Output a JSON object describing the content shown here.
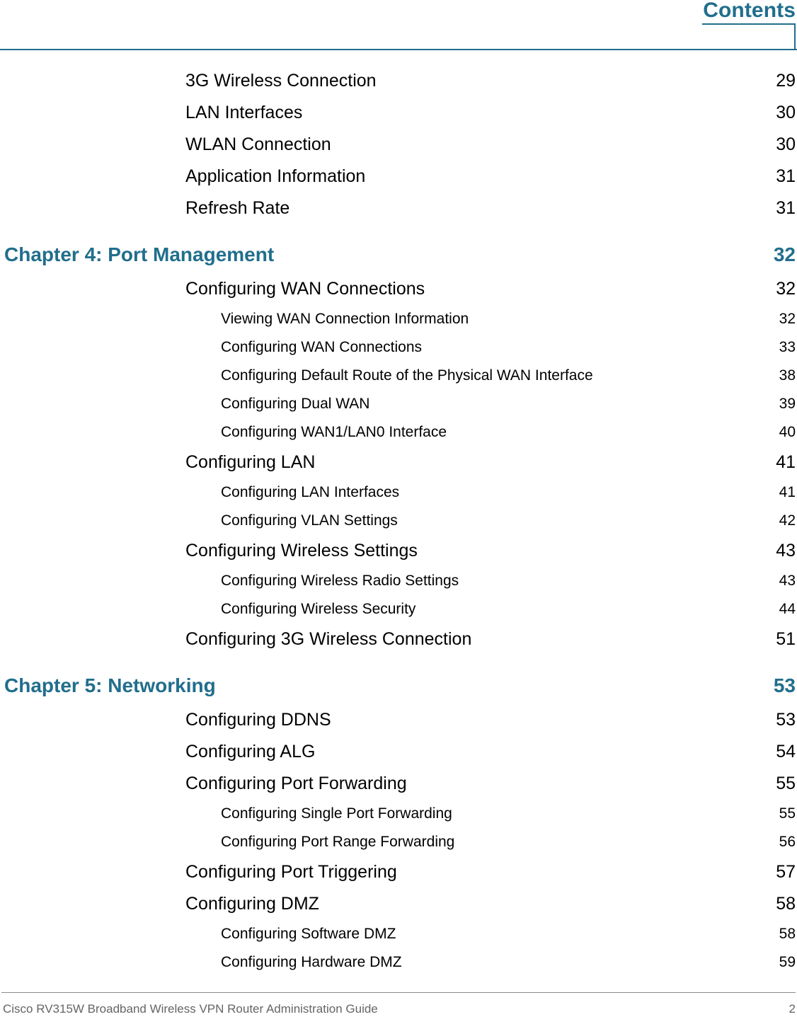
{
  "header": {
    "title": "Contents",
    "accent_color": "#216e8c"
  },
  "toc": {
    "entries": [
      {
        "level": 1,
        "label": "3G Wireless Connection",
        "page": "29"
      },
      {
        "level": 1,
        "label": "LAN Interfaces",
        "page": "30"
      },
      {
        "level": 1,
        "label": "WLAN Connection",
        "page": "30"
      },
      {
        "level": 1,
        "label": "Application Information",
        "page": "31"
      },
      {
        "level": 1,
        "label": "Refresh Rate",
        "page": "31"
      },
      {
        "level": 0,
        "label": "Chapter 4: Port Management",
        "page": "32"
      },
      {
        "level": 1,
        "label": "Configuring WAN Connections",
        "page": "32"
      },
      {
        "level": 2,
        "label": "Viewing WAN Connection Information",
        "page": "32"
      },
      {
        "level": 2,
        "label": "Configuring WAN Connections",
        "page": "33"
      },
      {
        "level": 2,
        "label": "Configuring Default Route of the Physical WAN Interface",
        "page": "38"
      },
      {
        "level": 2,
        "label": "Configuring Dual WAN",
        "page": "39"
      },
      {
        "level": 2,
        "label": "Configuring WAN1/LAN0 Interface",
        "page": "40"
      },
      {
        "level": 1,
        "label": "Configuring LAN",
        "page": "41"
      },
      {
        "level": 2,
        "label": "Configuring LAN Interfaces",
        "page": "41"
      },
      {
        "level": 2,
        "label": "Configuring VLAN Settings",
        "page": "42"
      },
      {
        "level": 1,
        "label": "Configuring Wireless Settings",
        "page": "43"
      },
      {
        "level": 2,
        "label": "Configuring Wireless Radio Settings",
        "page": "43"
      },
      {
        "level": 2,
        "label": "Configuring Wireless Security",
        "page": "44"
      },
      {
        "level": 1,
        "label": "Configuring 3G Wireless Connection",
        "page": "51"
      },
      {
        "level": 0,
        "label": "Chapter 5: Networking",
        "page": "53"
      },
      {
        "level": 1,
        "label": "Configuring DDNS",
        "page": "53"
      },
      {
        "level": 1,
        "label": "Configuring ALG",
        "page": "54"
      },
      {
        "level": 1,
        "label": "Configuring Port Forwarding",
        "page": "55"
      },
      {
        "level": 2,
        "label": "Configuring Single Port Forwarding",
        "page": "55"
      },
      {
        "level": 2,
        "label": "Configuring Port Range Forwarding",
        "page": "56"
      },
      {
        "level": 1,
        "label": "Configuring Port Triggering",
        "page": "57"
      },
      {
        "level": 1,
        "label": "Configuring DMZ",
        "page": "58"
      },
      {
        "level": 2,
        "label": "Configuring Software DMZ",
        "page": "58"
      },
      {
        "level": 2,
        "label": "Configuring Hardware DMZ",
        "page": "59"
      }
    ]
  },
  "footer": {
    "document_title": "Cisco RV315W Broadband Wireless VPN Router Administration Guide",
    "page_number": "2"
  }
}
